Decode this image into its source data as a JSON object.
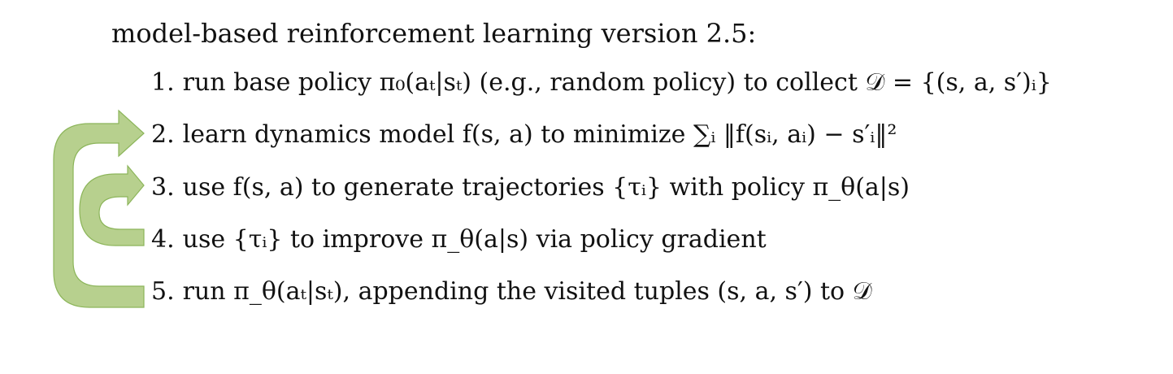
{
  "title": "model-based reinforcement learning version 2.5:",
  "steps": [
    {
      "number": "1.",
      "text": "run base policy π₀(aₜ|sₜ) (e.g., random policy) to collect 𝒟 = {(s, a, s′)ᵢ}"
    },
    {
      "number": "2.",
      "text": "learn dynamics model f(s, a) to minimize ∑ᵢ ‖f(sᵢ, aᵢ) − s′ᵢ‖²"
    },
    {
      "number": "3.",
      "text": "use f(s, a) to generate trajectories {τᵢ} with policy π_θ(a|s)"
    },
    {
      "number": "4.",
      "text": "use {τᵢ} to improve π_θ(a|s) via policy gradient"
    },
    {
      "number": "5.",
      "text": "run π_θ(aₜ|sₜ), appending the visited tuples (s, a, s′) to 𝒟"
    }
  ],
  "colors": {
    "arrow_fill": "#b7d08e",
    "arrow_stroke": "#8cb55a",
    "text": "#111111"
  }
}
